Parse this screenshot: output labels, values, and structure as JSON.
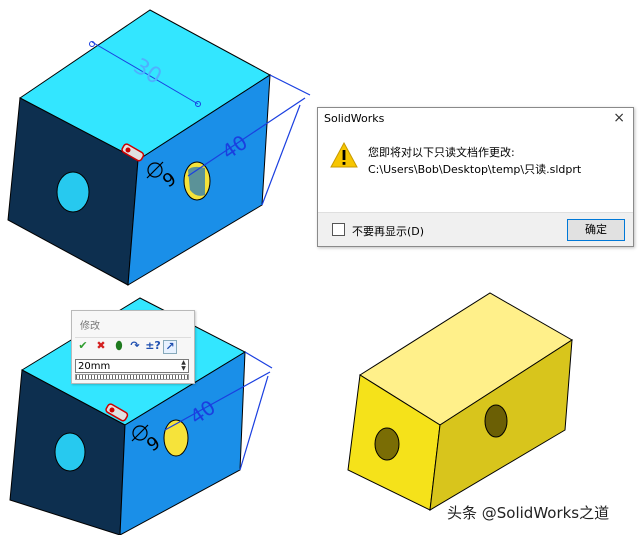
{
  "dialog": {
    "title": "SolidWorks",
    "close": "×",
    "message_line1": "您即将对以下只读文档作更改:",
    "message_line2": "C:\\Users\\Bob\\Desktop\\temp\\只读.sldprt",
    "checkbox_label": "不要再显示(D)",
    "ok_label": "确定"
  },
  "modify_popup": {
    "title": "修改",
    "value": "20mm",
    "tools": [
      {
        "icon": "check-icon",
        "glyph": "✔",
        "color": "#2e9d2e"
      },
      {
        "icon": "cancel-icon",
        "glyph": "✖",
        "color": "#d42020"
      },
      {
        "icon": "rebuild-icon",
        "glyph": "⬮",
        "color": "#1f7a1f"
      },
      {
        "icon": "reset-icon",
        "glyph": "↷",
        "color": "#2050b0"
      },
      {
        "icon": "mark-dimension-icon",
        "glyph": "±?",
        "color": "#2050b0"
      },
      {
        "icon": "select-icon",
        "glyph": "↗",
        "color": "#2050b0"
      }
    ]
  },
  "model_top": {
    "dimensions": [
      "30",
      "40",
      "9"
    ]
  },
  "model_bottom": {
    "dimensions": [
      "40",
      "9"
    ]
  },
  "watermark": "头条 @SolidWorks之道",
  "colors": {
    "cube_top": "#33e6ff",
    "cube_front_dark": "#0d2f4f",
    "cube_right": "#1a8fe8",
    "dimension_blue": "#1a3fe0",
    "yellow_front": "#f5e21a",
    "yellow_top": "#fff08a",
    "yellow_right": "#d8c51c"
  }
}
